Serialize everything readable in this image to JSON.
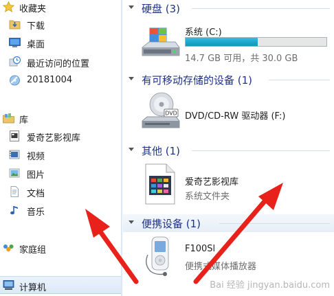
{
  "nav": {
    "favorites": {
      "label": "收藏夹"
    },
    "favorite_items": [
      "下载",
      "桌面",
      "最近访问的位置",
      "20181004"
    ],
    "libraries": {
      "label": "库"
    },
    "library_items": [
      "爱奇艺影视库",
      "视频",
      "图片",
      "文档",
      "音乐"
    ],
    "homegroup": {
      "label": "家庭组"
    },
    "computer": {
      "label": "计算机"
    }
  },
  "content": {
    "hard_disks": {
      "title": "硬盘 (3)",
      "drive_name": "系统 (C:)",
      "drive_free": "14.7 GB 可用，共 30.0 GB",
      "used_fraction": 0.51
    },
    "removable": {
      "title": "有可移动存储的设备 (1)",
      "dvd_name": "DVD/CD-RW 驱动器 (F:)"
    },
    "other": {
      "title": "其他 (1)",
      "item_name": "爱奇艺影视库",
      "item_type": "系统文件夹"
    },
    "portable": {
      "title": "便携设备 (1)",
      "device_name": "F100Sl",
      "device_type": "便携式媒体播放器"
    }
  },
  "annotations": {
    "arrow_color": "#e8221b"
  },
  "watermark": "Bai 经验 jingyan.baidu.com"
}
